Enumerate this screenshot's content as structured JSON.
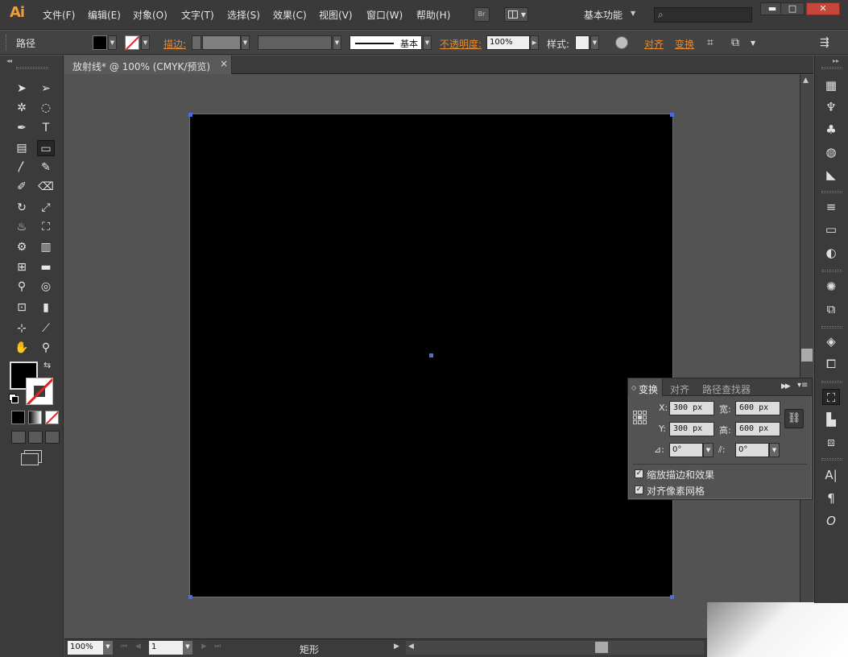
{
  "app": {
    "logo": "Ai",
    "menus": [
      "文件(F)",
      "编辑(E)",
      "对象(O)",
      "文字(T)",
      "选择(S)",
      "效果(C)",
      "视图(V)",
      "窗口(W)",
      "帮助(H)"
    ],
    "bridge_label": "Br",
    "workspace": "基本功能",
    "search_placeholder": "",
    "win_controls": {
      "minimize": "▬",
      "maximize": "□",
      "close": "✕"
    }
  },
  "control_bar": {
    "selection_type": "路径",
    "stroke_label": "描边:",
    "brush_label": "基本",
    "opacity_label": "不透明度:",
    "opacity_value": "100%",
    "style_label": "样式:",
    "align_label": "对齐",
    "transform_label": "变换"
  },
  "document": {
    "tab_title": "放射线* @ 100% (CMYK/预览)",
    "tab_close": "×",
    "artboard_fill": "#000000",
    "selection_color": "#4f6bd8"
  },
  "status_bar": {
    "zoom": "100%",
    "page": "1",
    "status_text": "矩形"
  },
  "transform_panel": {
    "tabs": [
      "变换",
      "对齐",
      "路径查找器"
    ],
    "x_label": "X:",
    "y_label": "Y:",
    "w_label": "宽:",
    "h_label": "高:",
    "x_value": "300 px",
    "y_value": "300 px",
    "w_value": "600 px",
    "h_value": "600 px",
    "rotate_value": "0°",
    "shear_value": "0°",
    "scale_strokes_label": "缩放描边和效果",
    "align_pixel_label": "对齐像素网格",
    "scale_strokes_checked": true,
    "align_pixel_checked": true
  },
  "colors": {
    "accent_orange": "#e68a2e",
    "logo_orange": "#ee9d3d",
    "ui_dark": "#3b3b3b",
    "canvas_bg": "#535353"
  }
}
